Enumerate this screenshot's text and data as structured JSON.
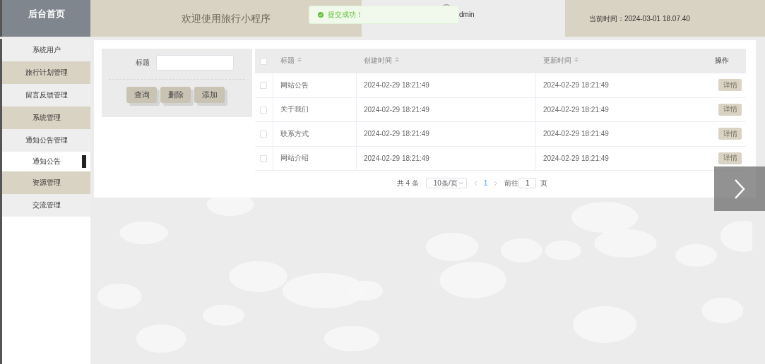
{
  "header": {
    "logo": "后台首页",
    "title": "欢迎使用旅行小程序",
    "user": "dmin",
    "time": "当前时间：2024-03-01 18.07.40"
  },
  "toast": {
    "kind": "success",
    "message": "提交成功！"
  },
  "sidebar": {
    "items": [
      {
        "label": "系统用户",
        "kind": "menu",
        "selected": false
      },
      {
        "label": "旅行计划管理",
        "kind": "menu",
        "selected": false
      },
      {
        "label": "留言反馈管理",
        "kind": "menu",
        "selected": false
      },
      {
        "label": "系统管理",
        "kind": "menu",
        "selected": false
      },
      {
        "label": "通知公告管理",
        "kind": "menu",
        "selected": false
      },
      {
        "label": "通知公告",
        "kind": "submenu",
        "selected": true
      },
      {
        "label": "资源管理",
        "kind": "menu",
        "selected": false
      },
      {
        "label": "交流管理",
        "kind": "menu",
        "selected": false
      }
    ]
  },
  "search": {
    "label": "标题",
    "buttons": [
      "查询",
      "删除",
      "添加"
    ]
  },
  "table": {
    "select_all_checked": false,
    "columns": [
      {
        "label": "标题",
        "sortable": true
      },
      {
        "label": "创建时间",
        "sortable": true
      },
      {
        "label": "更新时间",
        "sortable": true
      },
      {
        "label": "操作",
        "sortable": false
      }
    ],
    "rows": [
      {
        "checked": false,
        "cells": [
          "网站公告",
          "2024-02-29 18:21:49",
          "2024-02-29 18:21:49"
        ],
        "action": "详情"
      },
      {
        "checked": false,
        "cells": [
          "关于我们",
          "2024-02-29 18:21:49",
          "2024-02-29 18:21:49"
        ],
        "action": "详情"
      },
      {
        "checked": false,
        "cells": [
          "联系方式",
          "2024-02-29 18:21:49",
          "2024-02-29 18:21:49"
        ],
        "action": "详情"
      },
      {
        "checked": false,
        "cells": [
          "网站介绍",
          "2024-02-29 18:21:49",
          "2024-02-29 18:21:49"
        ],
        "action": "详情"
      }
    ]
  },
  "pagination": {
    "total": "共 4 条",
    "page_size": "10条/页",
    "pages": [
      {
        "label": "1",
        "selected": true
      }
    ],
    "goto_label": "前往",
    "goto_value": "1",
    "goto_suffix": "页"
  }
}
